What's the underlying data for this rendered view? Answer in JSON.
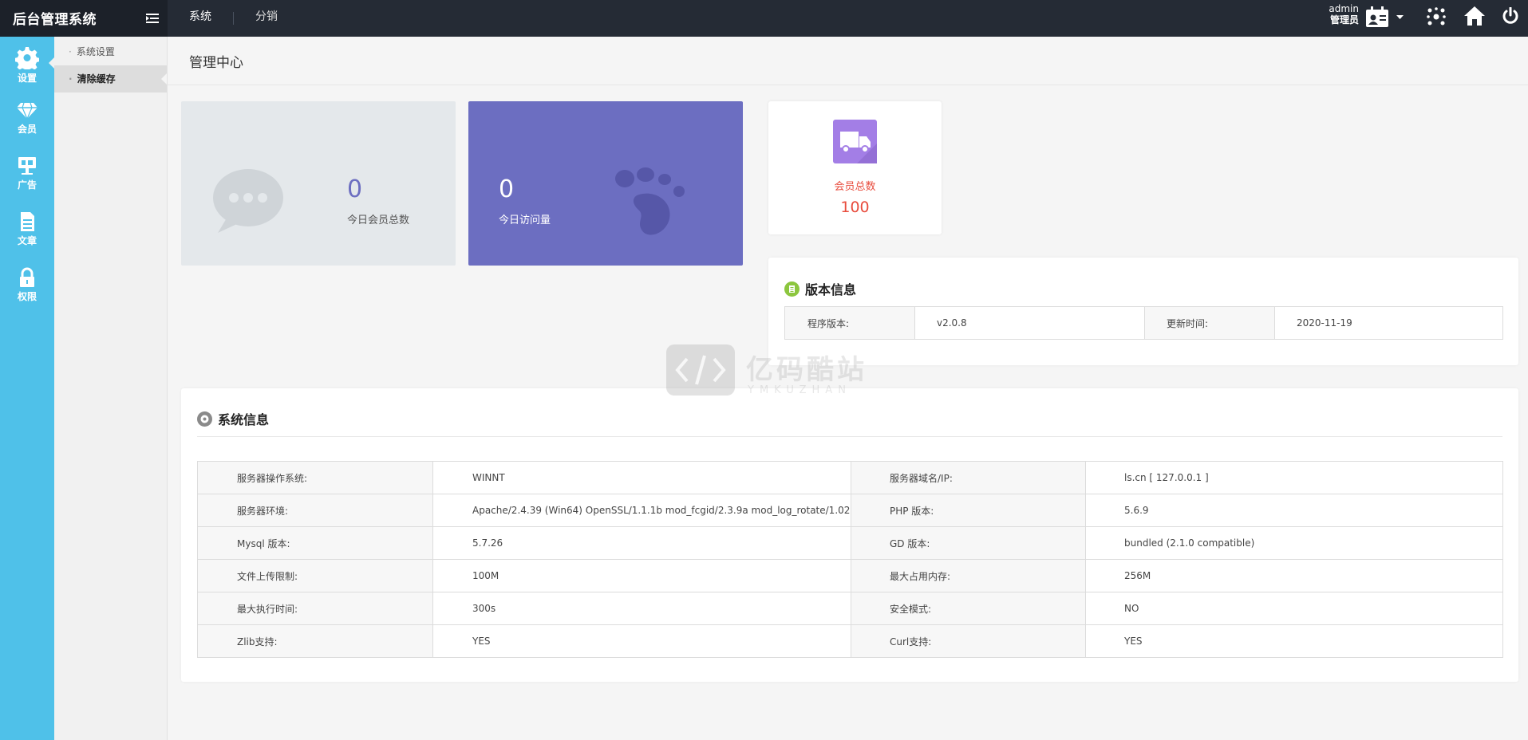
{
  "header": {
    "title": "后台管理系统",
    "tabs": [
      {
        "label": "系统"
      },
      {
        "label": "分销"
      }
    ],
    "user": {
      "name": "admin",
      "role": "管理员"
    }
  },
  "rail": {
    "items": [
      {
        "label": "设置",
        "icon": "gear-icon"
      },
      {
        "label": "会员",
        "icon": "diamond-icon"
      },
      {
        "label": "广告",
        "icon": "ad-icon"
      },
      {
        "label": "文章",
        "icon": "document-icon"
      },
      {
        "label": "权限",
        "icon": "lock-icon"
      }
    ]
  },
  "subnav": {
    "items": [
      {
        "label": "系统设置"
      },
      {
        "label": "清除缓存"
      }
    ]
  },
  "main": {
    "title": "管理中心",
    "stats": [
      {
        "value": "0",
        "label": "今日会员总数"
      },
      {
        "value": "0",
        "label": "今日访问量"
      }
    ],
    "member_card": {
      "label": "会员总数",
      "value": "100"
    },
    "version": {
      "title": "版本信息",
      "rows": [
        [
          "程序版本:",
          "v2.0.8",
          "更新时间:",
          "2020-11-19"
        ]
      ]
    },
    "system": {
      "title": "系统信息",
      "rows": [
        [
          "服务器操作系统:",
          "WINNT",
          "服务器域名/IP:",
          "ls.cn [ 127.0.0.1 ]"
        ],
        [
          "服务器环境:",
          "Apache/2.4.39 (Win64) OpenSSL/1.1.1b mod_fcgid/2.3.9a mod_log_rotate/1.02",
          "PHP 版本:",
          "5.6.9"
        ],
        [
          "Mysql 版本:",
          "5.7.26",
          "GD 版本:",
          "bundled (2.1.0 compatible)"
        ],
        [
          "文件上传限制:",
          "100M",
          "最大占用内存:",
          "256M"
        ],
        [
          "最大执行时间:",
          "300s",
          "安全模式:",
          "NO"
        ],
        [
          "Zlib支持:",
          "YES",
          "Curl支持:",
          "YES"
        ]
      ]
    }
  },
  "watermark": {
    "text": "亿码酷站",
    "sub": "YMKUZHAN"
  },
  "colors": {
    "topbar": "#252b35",
    "rail": "#4fc1e9",
    "stat_purple": "#6c6ec1",
    "member_red": "#e84c3d",
    "truck_purple": "#a37ee6"
  }
}
